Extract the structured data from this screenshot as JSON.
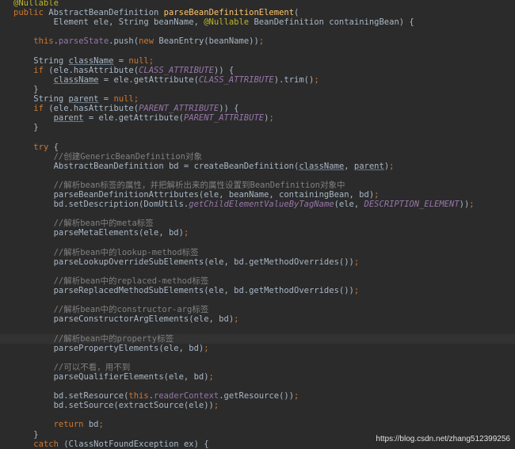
{
  "editor": {
    "lines": [
      [
        {
          "t": "@Nullable",
          "c": "ann"
        }
      ],
      [
        {
          "t": "public ",
          "c": "kw"
        },
        {
          "t": "AbstractBeanDefinition ",
          "c": "plain"
        },
        {
          "t": "parseBeanDefinitionElement",
          "c": "fn"
        },
        {
          "t": "(",
          "c": "plain"
        }
      ],
      [
        {
          "t": "        Element ele, String beanName, ",
          "c": "plain"
        },
        {
          "t": "@Nullable ",
          "c": "ann"
        },
        {
          "t": "BeanDefinition containingBean) {",
          "c": "plain"
        }
      ],
      [],
      [
        {
          "t": "    ",
          "c": "plain"
        },
        {
          "t": "this",
          "c": "kw"
        },
        {
          "t": ".",
          "c": "plain"
        },
        {
          "t": "parseState",
          "c": "field"
        },
        {
          "t": ".push(",
          "c": "plain"
        },
        {
          "t": "new ",
          "c": "kw"
        },
        {
          "t": "BeanEntry(beanName))",
          "c": "plain"
        },
        {
          "t": ";",
          "c": "kw"
        }
      ],
      [],
      [
        {
          "t": "    String ",
          "c": "plain"
        },
        {
          "t": "className",
          "c": "plain",
          "u": true
        },
        {
          "t": " = ",
          "c": "plain"
        },
        {
          "t": "null",
          "c": "kw"
        },
        {
          "t": ";",
          "c": "kw"
        }
      ],
      [
        {
          "t": "    ",
          "c": "plain"
        },
        {
          "t": "if ",
          "c": "kw"
        },
        {
          "t": "(ele.hasAttribute(",
          "c": "plain"
        },
        {
          "t": "CLASS_ATTRIBUTE",
          "c": "const"
        },
        {
          "t": ")) {",
          "c": "plain"
        }
      ],
      [
        {
          "t": "        ",
          "c": "plain"
        },
        {
          "t": "className",
          "c": "plain",
          "u": true
        },
        {
          "t": " = ele.getAttribute(",
          "c": "plain"
        },
        {
          "t": "CLASS_ATTRIBUTE",
          "c": "const"
        },
        {
          "t": ").trim()",
          "c": "plain"
        },
        {
          "t": ";",
          "c": "kw"
        }
      ],
      [
        {
          "t": "    }",
          "c": "plain"
        }
      ],
      [
        {
          "t": "    String ",
          "c": "plain"
        },
        {
          "t": "parent",
          "c": "plain",
          "u": true
        },
        {
          "t": " = ",
          "c": "plain"
        },
        {
          "t": "null",
          "c": "kw"
        },
        {
          "t": ";",
          "c": "kw"
        }
      ],
      [
        {
          "t": "    ",
          "c": "plain"
        },
        {
          "t": "if ",
          "c": "kw"
        },
        {
          "t": "(ele.hasAttribute(",
          "c": "plain"
        },
        {
          "t": "PARENT_ATTRIBUTE",
          "c": "const"
        },
        {
          "t": ")) {",
          "c": "plain"
        }
      ],
      [
        {
          "t": "        ",
          "c": "plain"
        },
        {
          "t": "parent",
          "c": "plain",
          "u": true
        },
        {
          "t": " = ele.getAttribute(",
          "c": "plain"
        },
        {
          "t": "PARENT_ATTRIBUTE",
          "c": "const"
        },
        {
          "t": ")",
          "c": "plain"
        },
        {
          "t": ";",
          "c": "kw"
        }
      ],
      [
        {
          "t": "    }",
          "c": "plain"
        }
      ],
      [],
      [
        {
          "t": "    ",
          "c": "plain"
        },
        {
          "t": "try ",
          "c": "kw"
        },
        {
          "t": "{",
          "c": "plain"
        }
      ],
      [
        {
          "t": "        //创建GenericBeanDefinition对象",
          "c": "cmt"
        }
      ],
      [
        {
          "t": "        AbstractBeanDefinition bd = createBeanDefinition(",
          "c": "plain"
        },
        {
          "t": "className",
          "c": "plain",
          "u": true
        },
        {
          "t": ", ",
          "c": "plain"
        },
        {
          "t": "parent",
          "c": "plain",
          "u": true
        },
        {
          "t": ")",
          "c": "plain"
        },
        {
          "t": ";",
          "c": "kw"
        }
      ],
      [],
      [
        {
          "t": "        //解析bean标签的属性，并把解析出来的属性设置到BeanDefinition对象中",
          "c": "cmt"
        }
      ],
      [
        {
          "t": "        parseBeanDefinitionAttributes(ele, beanName, containingBean, bd)",
          "c": "plain"
        },
        {
          "t": ";",
          "c": "kw"
        }
      ],
      [
        {
          "t": "        bd.setDescription(DomUtils.",
          "c": "plain"
        },
        {
          "t": "getChildElementValueByTagName",
          "c": "const"
        },
        {
          "t": "(ele, ",
          "c": "plain"
        },
        {
          "t": "DESCRIPTION_ELEMENT",
          "c": "const"
        },
        {
          "t": "))",
          "c": "plain"
        },
        {
          "t": ";",
          "c": "kw"
        }
      ],
      [],
      [
        {
          "t": "        //解析bean中的meta标签",
          "c": "cmt"
        }
      ],
      [
        {
          "t": "        parseMetaElements(ele, bd)",
          "c": "plain"
        },
        {
          "t": ";",
          "c": "kw"
        }
      ],
      [],
      [
        {
          "t": "        //解析bean中的lookup-method标签",
          "c": "cmt"
        }
      ],
      [
        {
          "t": "        parseLookupOverrideSubElements(ele, bd.getMethodOverrides())",
          "c": "plain"
        },
        {
          "t": ";",
          "c": "kw"
        }
      ],
      [],
      [
        {
          "t": "        //解析bean中的replaced-method标签",
          "c": "cmt"
        }
      ],
      [
        {
          "t": "        parseReplacedMethodSubElements(ele, bd.getMethodOverrides())",
          "c": "plain"
        },
        {
          "t": ";",
          "c": "kw"
        }
      ],
      [],
      [
        {
          "t": "        //解析bean中的constructor-arg标签",
          "c": "cmt"
        }
      ],
      [
        {
          "t": "        parseConstructorArgElements(ele, bd)",
          "c": "plain"
        },
        {
          "t": ";",
          "c": "kw"
        }
      ],
      [],
      [
        {
          "t": "        //解析bean中的property标签",
          "c": "cmt"
        }
      ],
      [
        {
          "t": "        parsePropertyElements(ele, bd)",
          "c": "plain"
        },
        {
          "t": ";",
          "c": "kw"
        }
      ],
      [],
      [
        {
          "t": "        //可以不看，用不到",
          "c": "cmt"
        }
      ],
      [
        {
          "t": "        parseQualifierElements(ele, bd)",
          "c": "plain"
        },
        {
          "t": ";",
          "c": "kw"
        }
      ],
      [],
      [
        {
          "t": "        bd.setResource(",
          "c": "plain"
        },
        {
          "t": "this",
          "c": "kw"
        },
        {
          "t": ".",
          "c": "plain"
        },
        {
          "t": "readerContext",
          "c": "field"
        },
        {
          "t": ".getResource())",
          "c": "plain"
        },
        {
          "t": ";",
          "c": "kw"
        }
      ],
      [
        {
          "t": "        bd.setSource(extractSource(ele))",
          "c": "plain"
        },
        {
          "t": ";",
          "c": "kw"
        }
      ],
      [],
      [
        {
          "t": "        ",
          "c": "plain"
        },
        {
          "t": "return ",
          "c": "kw"
        },
        {
          "t": "bd",
          "c": "plain"
        },
        {
          "t": ";",
          "c": "kw"
        }
      ],
      [
        {
          "t": "    }",
          "c": "plain"
        }
      ],
      [
        {
          "t": "    ",
          "c": "plain"
        },
        {
          "t": "catch ",
          "c": "kw"
        },
        {
          "t": "(ClassNotFoundException ex) {",
          "c": "plain"
        }
      ]
    ]
  },
  "watermark": {
    "text": "https://blog.csdn.net/zhang512399256"
  }
}
